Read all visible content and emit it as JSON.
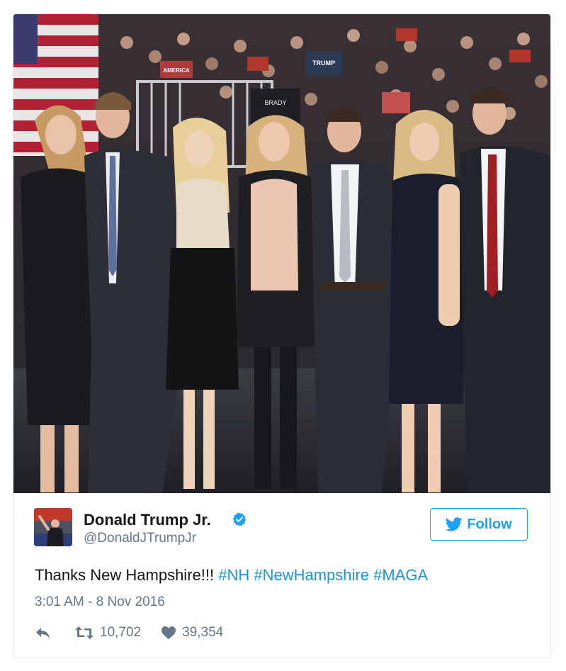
{
  "tweet": {
    "user": {
      "display_name": "Donald Trump Jr.",
      "handle": "@DonaldJTrumpJr",
      "verified": true
    },
    "follow_button": {
      "label": "Follow"
    },
    "text_plain": "Thanks New Hampshire!!!",
    "hashtags": [
      "#NH",
      "#NewHampshire",
      "#MAGA"
    ],
    "timestamp": "3:01 AM - 8 Nov 2016",
    "actions": {
      "reply_icon": "reply-icon",
      "retweet_count": "10,702",
      "like_count": "39,354"
    },
    "photo_signs": {
      "sign_1": "TRUMP",
      "sign_2": "AMERICA",
      "shirt": "BRADY"
    },
    "colors": {
      "accent": "#1da1f2",
      "hashtag": "#1b95e0",
      "text": "#14171a",
      "muted": "#657786",
      "border": "#e1e8ed"
    }
  }
}
